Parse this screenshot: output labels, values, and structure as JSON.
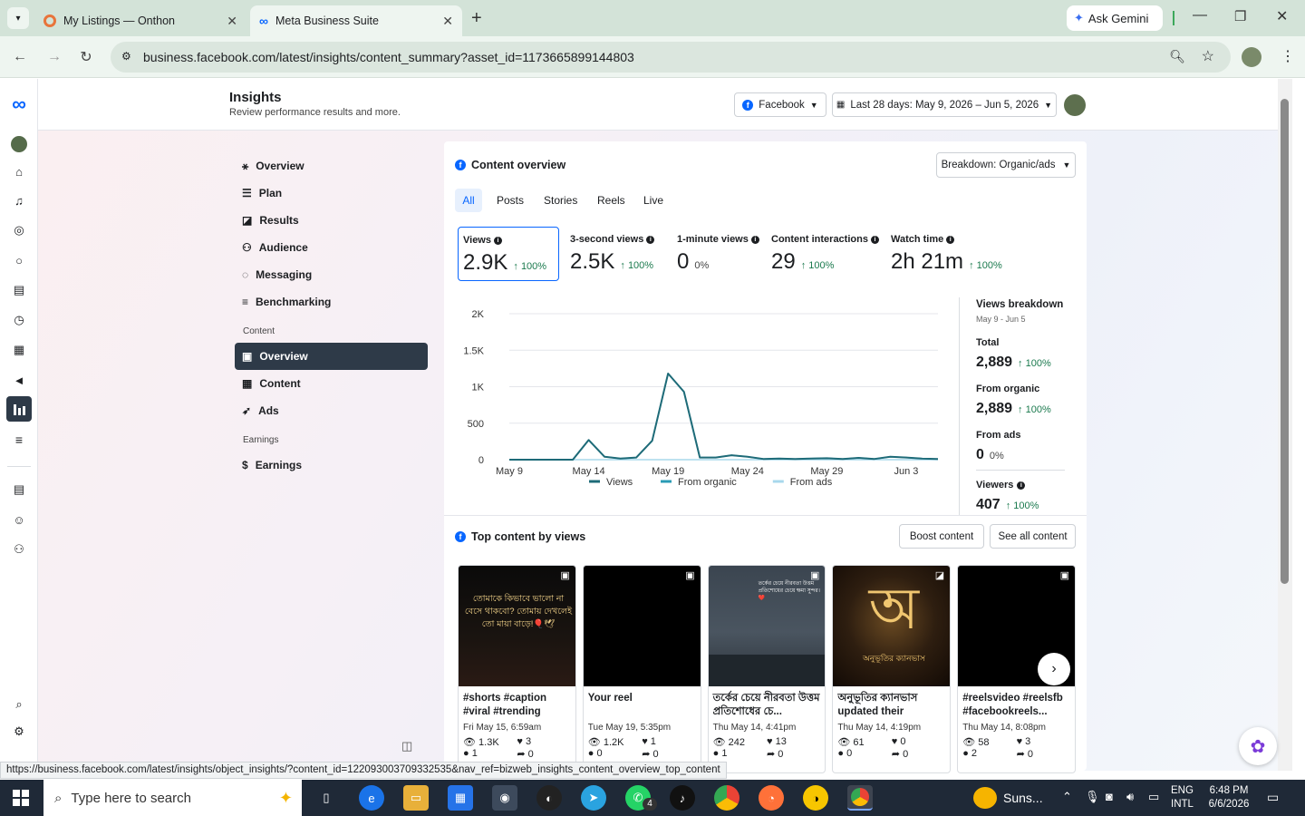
{
  "browser": {
    "tabs": [
      {
        "title": "My Listings — Onthon"
      },
      {
        "title": "Meta Business Suite"
      }
    ],
    "url": "business.facebook.com/latest/insights/content_summary?asset_id=1173665899144803",
    "ask_gemini": "Ask Gemini"
  },
  "header": {
    "title": "Insights",
    "subtitle": "Review performance results and more.",
    "platform": "Facebook",
    "date_range": "Last 28 days: May 9, 2026 – Jun 5, 2026"
  },
  "sidebar": {
    "items": [
      {
        "label": "Overview"
      },
      {
        "label": "Plan"
      },
      {
        "label": "Results"
      },
      {
        "label": "Audience"
      },
      {
        "label": "Messaging"
      },
      {
        "label": "Benchmarking"
      }
    ],
    "content_section": "Content",
    "content_items": [
      {
        "label": "Overview"
      },
      {
        "label": "Content"
      },
      {
        "label": "Ads"
      }
    ],
    "earnings_section": "Earnings",
    "earnings_items": [
      {
        "label": "Earnings"
      }
    ]
  },
  "content_overview": {
    "title": "Content overview",
    "breakdown": "Breakdown: Organic/ads",
    "tabs": [
      "All",
      "Posts",
      "Stories",
      "Reels",
      "Live"
    ],
    "metrics": [
      {
        "label": "Views",
        "value": "2.9K",
        "change": "100%"
      },
      {
        "label": "3-second views",
        "value": "2.5K",
        "change": "100%"
      },
      {
        "label": "1-minute views",
        "value": "0",
        "change": "0%"
      },
      {
        "label": "Content interactions",
        "value": "29",
        "change": "100%"
      },
      {
        "label": "Watch time",
        "value": "2h 21m",
        "change": "100%"
      }
    ]
  },
  "chart_data": {
    "type": "line",
    "x": [
      "May 9",
      "May 10",
      "May 11",
      "May 12",
      "May 13",
      "May 14",
      "May 15",
      "May 16",
      "May 17",
      "May 18",
      "May 19",
      "May 20",
      "May 21",
      "May 22",
      "May 23",
      "May 24",
      "May 25",
      "May 26",
      "May 27",
      "May 28",
      "May 29",
      "May 30",
      "May 31",
      "Jun 1",
      "Jun 2",
      "Jun 3",
      "Jun 4",
      "Jun 5"
    ],
    "tick_labels": [
      "May 9",
      "May 14",
      "May 19",
      "May 24",
      "May 29",
      "Jun 3"
    ],
    "y_ticks": [
      "0",
      "500",
      "1K",
      "1.5K",
      "2K"
    ],
    "ylim": [
      0,
      2000
    ],
    "series": [
      {
        "name": "Views",
        "color": "#1e6b78",
        "values": [
          0,
          0,
          0,
          0,
          0,
          270,
          40,
          15,
          30,
          260,
          1180,
          930,
          30,
          30,
          60,
          40,
          10,
          15,
          10,
          15,
          20,
          10,
          25,
          10,
          40,
          30,
          15,
          10
        ]
      },
      {
        "name": "From organic",
        "color": "#2a9bb5",
        "values": [
          0,
          0,
          0,
          0,
          0,
          270,
          40,
          15,
          30,
          260,
          1180,
          930,
          30,
          30,
          60,
          40,
          10,
          15,
          10,
          15,
          20,
          10,
          25,
          10,
          40,
          30,
          15,
          10
        ]
      },
      {
        "name": "From ads",
        "color": "#a8d8ec",
        "values": [
          0,
          0,
          0,
          0,
          0,
          0,
          0,
          0,
          0,
          0,
          0,
          0,
          0,
          0,
          0,
          0,
          0,
          0,
          0,
          0,
          0,
          0,
          0,
          0,
          0,
          0,
          0,
          0
        ]
      }
    ],
    "legend_position": "bottom",
    "grid": true
  },
  "breakdown": {
    "title": "Views breakdown",
    "range": "May 9 - Jun 5",
    "rows": [
      {
        "label": "Total",
        "value": "2,889",
        "change": "100%"
      },
      {
        "label": "From organic",
        "value": "2,889",
        "change": "100%"
      },
      {
        "label": "From ads",
        "value": "0",
        "change": "0%"
      },
      {
        "label": "Viewers",
        "value": "407",
        "change": "100%"
      }
    ]
  },
  "top_content": {
    "title": "Top content by views",
    "boost": "Boost content",
    "see_all": "See all content",
    "items": [
      {
        "caption": "#shorts #caption #viral #trending #foryou...",
        "date": "Fri May 15, 6:59am",
        "views": "1.3K",
        "likes": "3",
        "comments": "1",
        "shares": "0",
        "overlay": "তোমাকে কিভাবে ভালো না বেসে থাকবো? তোমায় দেখলেই তো মায়া বাড়ে!🎈🕊"
      },
      {
        "caption": "Your reel",
        "date": "Tue May 19, 5:35pm",
        "views": "1.2K",
        "likes": "1",
        "comments": "0",
        "shares": "0",
        "overlay": ""
      },
      {
        "caption": "তর্কের চেয়ে নীরবতা উত্তম প্রতিশোধের চে...",
        "date": "Thu May 14, 4:41pm",
        "views": "242",
        "likes": "13",
        "comments": "1",
        "shares": "0",
        "overlay": "তর্কের চেয়ে নীরবতা উত্তম প্রতিশোধের চেয়ে ক্ষমা সুন্দর।❤️"
      },
      {
        "caption": "অনুভূতির ক্যানভাস updated their profile...",
        "date": "Thu May 14, 4:19pm",
        "views": "61",
        "likes": "0",
        "comments": "0",
        "shares": "0",
        "overlay": "অ",
        "overlay_sub": "অনুভূতির ক্যানভাস"
      },
      {
        "caption": "#reelsvideo #reelsfb #facebookreels...",
        "date": "Thu May 14, 8:08pm",
        "views": "58",
        "likes": "3",
        "comments": "2",
        "shares": "0",
        "overlay": ""
      }
    ]
  },
  "status_bar_url": "https://business.facebook.com/latest/insights/object_insights/?content_id=122093003709332535&nav_ref=bizweb_insights_content_overview_top_content",
  "taskbar": {
    "search_placeholder": "Type here to search",
    "weather": "Suns...",
    "lang1": "ENG",
    "lang2": "INTL",
    "time": "6:48 PM",
    "date": "6/6/2026",
    "whatsapp_badge": "4"
  }
}
